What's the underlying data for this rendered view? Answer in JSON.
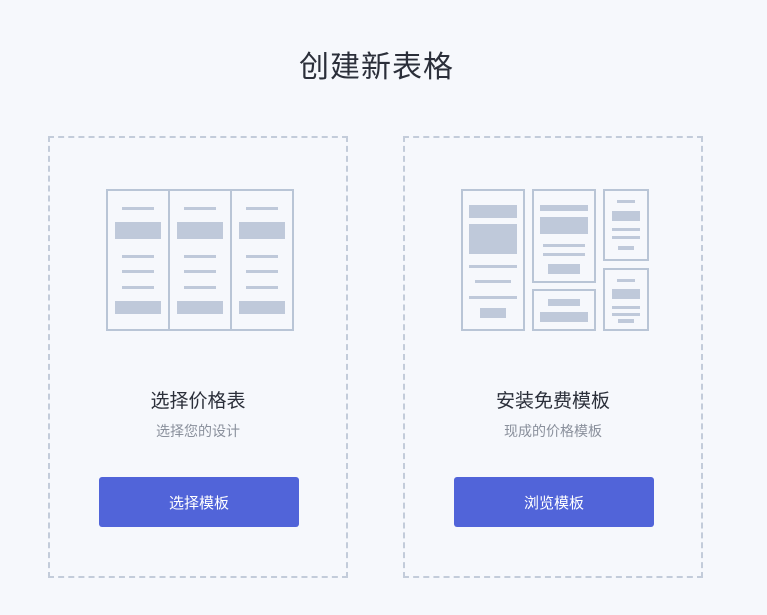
{
  "page": {
    "title": "创建新表格"
  },
  "cards": [
    {
      "title": "选择价格表",
      "subtitle": "选择您的设计",
      "button_label": "选择模板",
      "illustration": "three-column-pricing-table-icon"
    },
    {
      "title": "安装免费模板",
      "subtitle": "现成的价格模板",
      "button_label": "浏览模板",
      "illustration": "template-gallery-icon"
    }
  ],
  "colors": {
    "background": "#f6f8fc",
    "border_dashed": "#c3ccda",
    "illustration_stroke": "#b9c5d6",
    "illustration_fill": "#bfc9da",
    "button": "#5164d9",
    "title_text": "#2b2f3a",
    "subtitle_text": "#8a909c"
  }
}
